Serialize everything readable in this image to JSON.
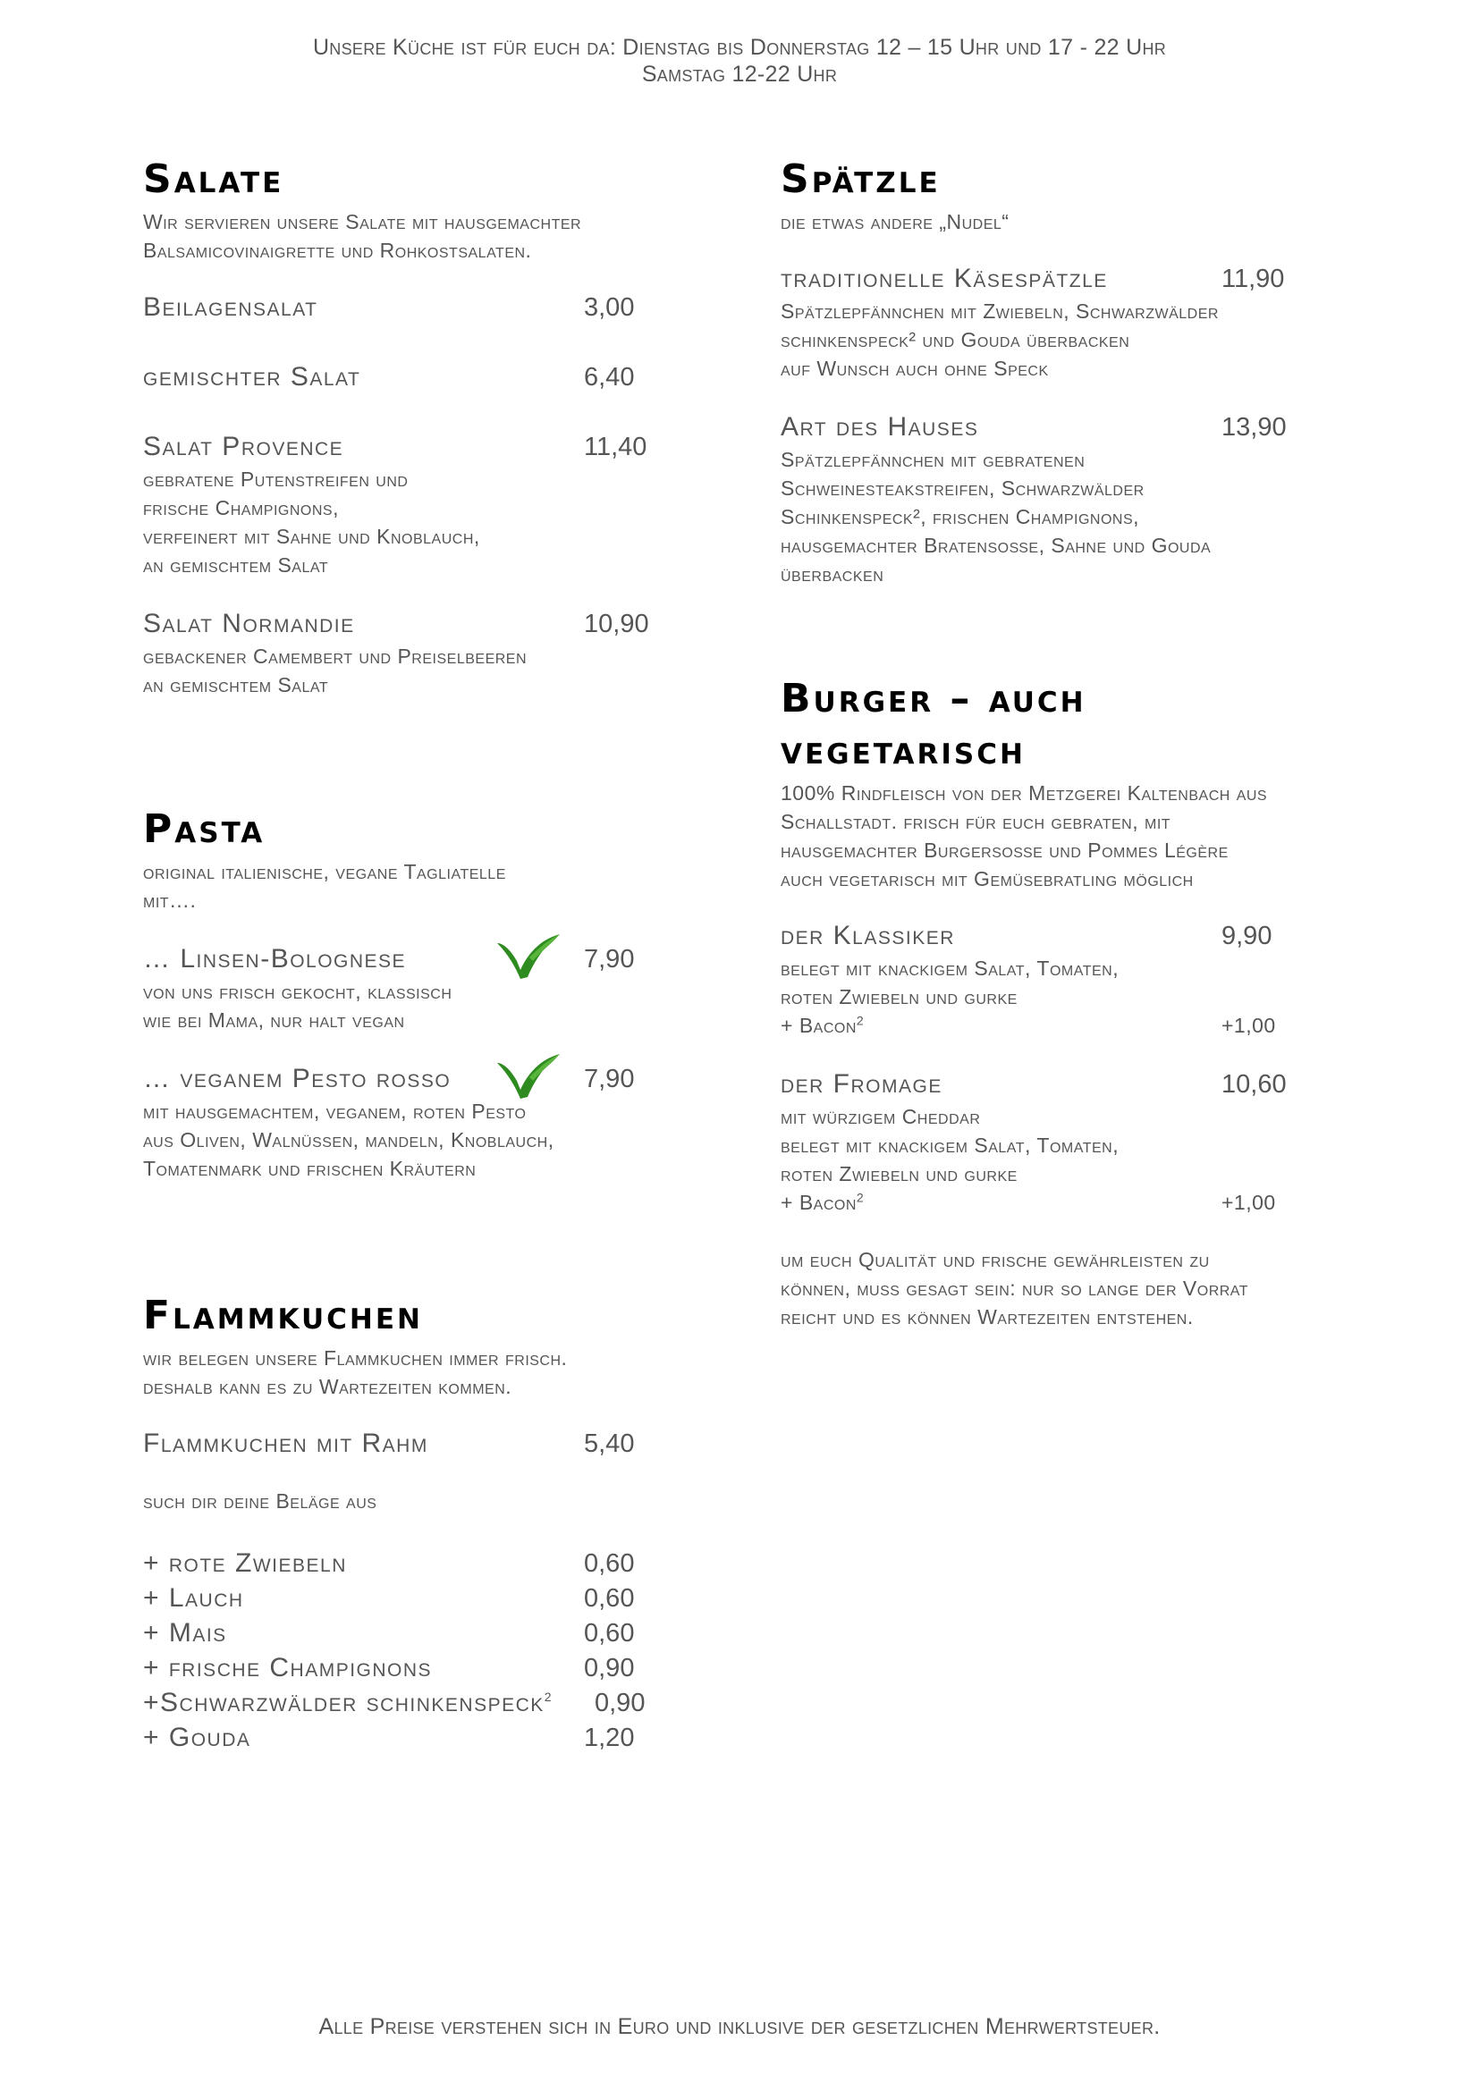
{
  "header": {
    "hours_line1": "Unsere Küche ist für euch da: Dienstag bis Donnerstag 12 – 15 Uhr und 17 - 22 Uhr",
    "hours_line2": "Samstag 12-22 Uhr"
  },
  "salate": {
    "title": "Salate",
    "desc_line1": "Wir servieren unsere Salate mit hausgemachter",
    "desc_line2": "Balsamicovinaigrette und Rohkostsalaten.",
    "items": [
      {
        "name": "Beilagensalat",
        "price": "3,00"
      },
      {
        "name": "gemischter Salat",
        "price": "6,40"
      },
      {
        "name": "Salat Provence",
        "price": "11,40",
        "desc": [
          "gebratene Putenstreifen und",
          "frische Champignons,",
          "verfeinert mit Sahne und Knoblauch,",
          "an gemischtem Salat"
        ]
      },
      {
        "name": "Salat Normandie",
        "price": "10,90",
        "desc": [
          "gebackener Camembert und Preiselbeeren",
          "an gemischtem Salat"
        ]
      }
    ]
  },
  "pasta": {
    "title": "Pasta",
    "desc_line1": "original italienische, vegane Tagliatelle",
    "desc_line2": "mit….",
    "items": [
      {
        "name": "… Linsen-Bolognese",
        "price": "7,90",
        "desc": [
          "von uns frisch gekocht, klassisch",
          "wie bei Mama, nur halt vegan"
        ]
      },
      {
        "name": "… veganem Pesto rosso",
        "price": "7,90",
        "desc": [
          "mit hausgemachtem, veganem, roten Pesto",
          "aus Oliven, Walnüssen, mandeln, Knoblauch,",
          "Tomatenmark und frischen Kräutern"
        ]
      }
    ]
  },
  "flammkuchen": {
    "title": "Flammkuchen",
    "desc_line1": "wir belegen unsere Flammkuchen immer frisch.",
    "desc_line2": "deshalb kann es zu Wartezeiten kommen.",
    "base_name": "Flammkuchen mit Rahm",
    "base_price": "5,40",
    "toppings_intro": "such dir deine Beläge aus",
    "toppings": [
      {
        "name": "+ rote Zwiebeln",
        "price": "0,60"
      },
      {
        "name": "+ Lauch",
        "price": "0,60"
      },
      {
        "name": "+ Mais",
        "price": "0,60"
      },
      {
        "name": "+ frische Champignons",
        "price": "0,90"
      },
      {
        "name": "+Schwarzwälder schinkenspeck",
        "sup": "2",
        "price": "0,90"
      },
      {
        "name": "+ Gouda",
        "price": "1,20"
      }
    ]
  },
  "spaetzle": {
    "title": "Spätzle",
    "desc": "die etwas andere „Nudel“",
    "items": [
      {
        "name": "traditionelle Käsespätzle",
        "price": "11,90",
        "desc": [
          "Spätzlepfännchen mit Zwiebeln, Schwarzwälder",
          "schinkenspeck² und Gouda überbacken",
          "auf Wunsch auch ohne Speck"
        ]
      },
      {
        "name": "Art des Hauses",
        "price": "13,90",
        "desc": [
          "Spätzlepfännchen mit gebratenen",
          "Schweinesteakstreifen, Schwarzwälder",
          "Schinkenspeck², frischen Champignons,",
          "hausgemachter Bratensoße, Sahne und Gouda",
          "überbacken"
        ]
      }
    ]
  },
  "burger": {
    "title_line1": "Burger – auch",
    "title_line2": "vegetarisch",
    "desc": [
      "100% Rindfleisch von der Metzgerei Kaltenbach aus",
      "Schallstadt. frisch für euch gebraten, mit",
      "hausgemachter Burgersoße und Pommes Légère",
      "auch vegetarisch mit Gemüsebratling möglich"
    ],
    "items": [
      {
        "name": "der Klassiker",
        "price": "9,90",
        "desc": [
          "belegt mit knackigem Salat, Tomaten,",
          "roten Zwiebeln und gurke"
        ],
        "addon": "+ Bacon",
        "addon_sup": "2",
        "addon_price": "+1,00"
      },
      {
        "name": "der Fromage",
        "price": "10,60",
        "desc": [
          "mit würzigem Cheddar",
          "belegt mit knackigem Salat, Tomaten,",
          "roten Zwiebeln und gurke"
        ],
        "addon": "+ Bacon",
        "addon_sup": "2",
        "addon_price": "+1,00"
      }
    ],
    "note": [
      "um euch Qualität und frische gewährleisten zu",
      "können, muss gesagt sein: nur so lange der Vorrat",
      "reicht und es können Wartezeiten entstehen."
    ]
  },
  "footer": {
    "text": "Alle Preise verstehen sich in Euro und inklusive der gesetzlichen Mehrwertsteuer."
  },
  "colors": {
    "heading": "#000000",
    "text": "#555555",
    "vegan_icon": "#2e8b1f"
  },
  "icons": {
    "vegan": "vegan-v-leaf-icon"
  }
}
